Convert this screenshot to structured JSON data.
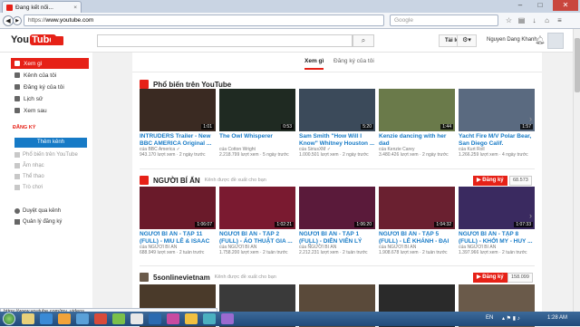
{
  "browser": {
    "tab_title": "Đang kết nối...",
    "url_scheme": "https://",
    "url_host": "www.youtube.com",
    "google_placeholder": "Google",
    "status_url": "https://www.youtube.com/my_videos"
  },
  "header": {
    "logo_you": "You",
    "logo_tube": "Tube",
    "upload_label": "Tải lên",
    "user_name": "Nguyen Dang Khanh"
  },
  "sidebar": {
    "items": [
      {
        "label": "Xem gì"
      },
      {
        "label": "Kênh của tôi"
      },
      {
        "label": "Đăng ký của tôi"
      },
      {
        "label": "Lịch sử"
      },
      {
        "label": "Xem sau"
      }
    ],
    "subs_heading": "ĐĂNG KÝ",
    "browse_label": "Thêm kênh",
    "subs": [
      {
        "label": "Phổ biến trên YouTube"
      },
      {
        "label": "Âm nhạc"
      },
      {
        "label": "Thể thao"
      },
      {
        "label": "Trò chơi"
      }
    ],
    "browse_channels": "Duyệt qua kênh",
    "manage_subs": "Quản lý đăng ký"
  },
  "tabs": [
    {
      "label": "Xem gì"
    },
    {
      "label": "Đăng ký của tôi"
    }
  ],
  "shelves": [
    {
      "title": "Phổ biến trên YouTube",
      "subtitle": "",
      "videos": [
        {
          "title": "INTRUDERS Trailer - New BBC AMERICA Original ...",
          "channel": "của BBC America ✓",
          "meta": "943.170 lượt xem · 2 ngày trước",
          "duration": "1:01",
          "color": "#3a2a22"
        },
        {
          "title": "The Owl Whisperer",
          "channel": "của Cotton Wright",
          "meta": "2.218.799 lượt xem · 5 ngày trước",
          "duration": "0:53",
          "color": "#1f2a22"
        },
        {
          "title": "Sam Smith \"How Will I Know\" Whitney Houston ...",
          "channel": "của SiriusXM ✓",
          "meta": "1.000.501 lượt xem · 2 ngày trước",
          "duration": "5:20",
          "color": "#3b4a5a"
        },
        {
          "title": "Kenzie dancing with her dad",
          "channel": "của Kenzie Carey",
          "meta": "3.480.426 lượt xem · 2 ngày trước",
          "duration": "1:44",
          "color": "#6a7a4a"
        },
        {
          "title": "Yacht Fire M/V Polar Bear, San Diego Calif.",
          "channel": "của Kurt Roll",
          "meta": "1.266.259 lượt xem · 4 ngày trước",
          "duration": "1:57",
          "color": "#5a6a80"
        }
      ]
    },
    {
      "title": "NGƯỜI BÍ ẨN",
      "subtitle": "Kênh được đề xuất cho bạn",
      "subscribe_label": "Đăng ký",
      "sub_count": "68.573",
      "videos": [
        {
          "title": "NGƯỜI BÍ ẨN - TẬP 11 (FULL) - MIU LÊ & ISAAC",
          "channel": "của NGƯỜI BÍ ẨN",
          "meta": "688.949 lượt xem · 2 tuần trước",
          "duration": "1:06:07",
          "color": "#6a1a2a"
        },
        {
          "title": "NGƯỜI BÍ ẨN - TẬP 2 (FULL) - ÁO THUẬT GIA ...",
          "channel": "của NGƯỜI BÍ ẨN",
          "meta": "1.758.200 lượt xem · 2 tuần trước",
          "duration": "1:02:21",
          "color": "#7a1a30"
        },
        {
          "title": "NGƯỜI BÍ ẨN - TẬP 1 (FULL) - DIỄN VIÊN LÝ NHÃ KỲ & ...",
          "channel": "của NGƯỜI BÍ ẨN",
          "meta": "2.212.231 lượt xem · 2 tuần trước",
          "duration": "1:06:20",
          "color": "#5a1a3a"
        },
        {
          "title": "NGƯỜI BÍ ẨN - TẬP 5 (FULL) - LÊ KHÁNH - ĐẠI ...",
          "channel": "của NGƯỜI BÍ ẨN",
          "meta": "1.908.678 lượt xem · 2 tuần trước",
          "duration": "1:04:32",
          "color": "#6a2030"
        },
        {
          "title": "NGƯỜI BÍ ẨN - TẬP 8 (FULL) - KHỞI MY - HUY ...",
          "channel": "của NGƯỜI BÍ ẨN",
          "meta": "1.397.966 lượt xem · 2 tuần trước",
          "duration": "1:07:33",
          "color": "#3a2a60"
        }
      ]
    },
    {
      "title": "5sonlinevietnam",
      "subtitle": "Kênh được đề xuất cho bạn",
      "subscribe_label": "Đăng ký",
      "sub_count": "158.099",
      "videos": [
        {
          "title": "",
          "channel": "",
          "meta": "",
          "duration": "",
          "color": "#4a3a2a"
        },
        {
          "title": "",
          "channel": "",
          "meta": "",
          "duration": "",
          "color": "#3a3a3a"
        },
        {
          "title": "",
          "channel": "",
          "meta": "",
          "duration": "",
          "color": "#5a4a3a"
        },
        {
          "title": "",
          "channel": "",
          "meta": "",
          "duration": "",
          "color": "#2a2a2a"
        },
        {
          "title": "",
          "channel": "",
          "meta": "",
          "duration": "",
          "color": "#6a5a4a"
        }
      ]
    }
  ],
  "taskbar": {
    "lang": "EN",
    "time": "1:28 AM"
  },
  "colors": {
    "brand_red": "#e62117",
    "link_blue": "#167ac6"
  }
}
